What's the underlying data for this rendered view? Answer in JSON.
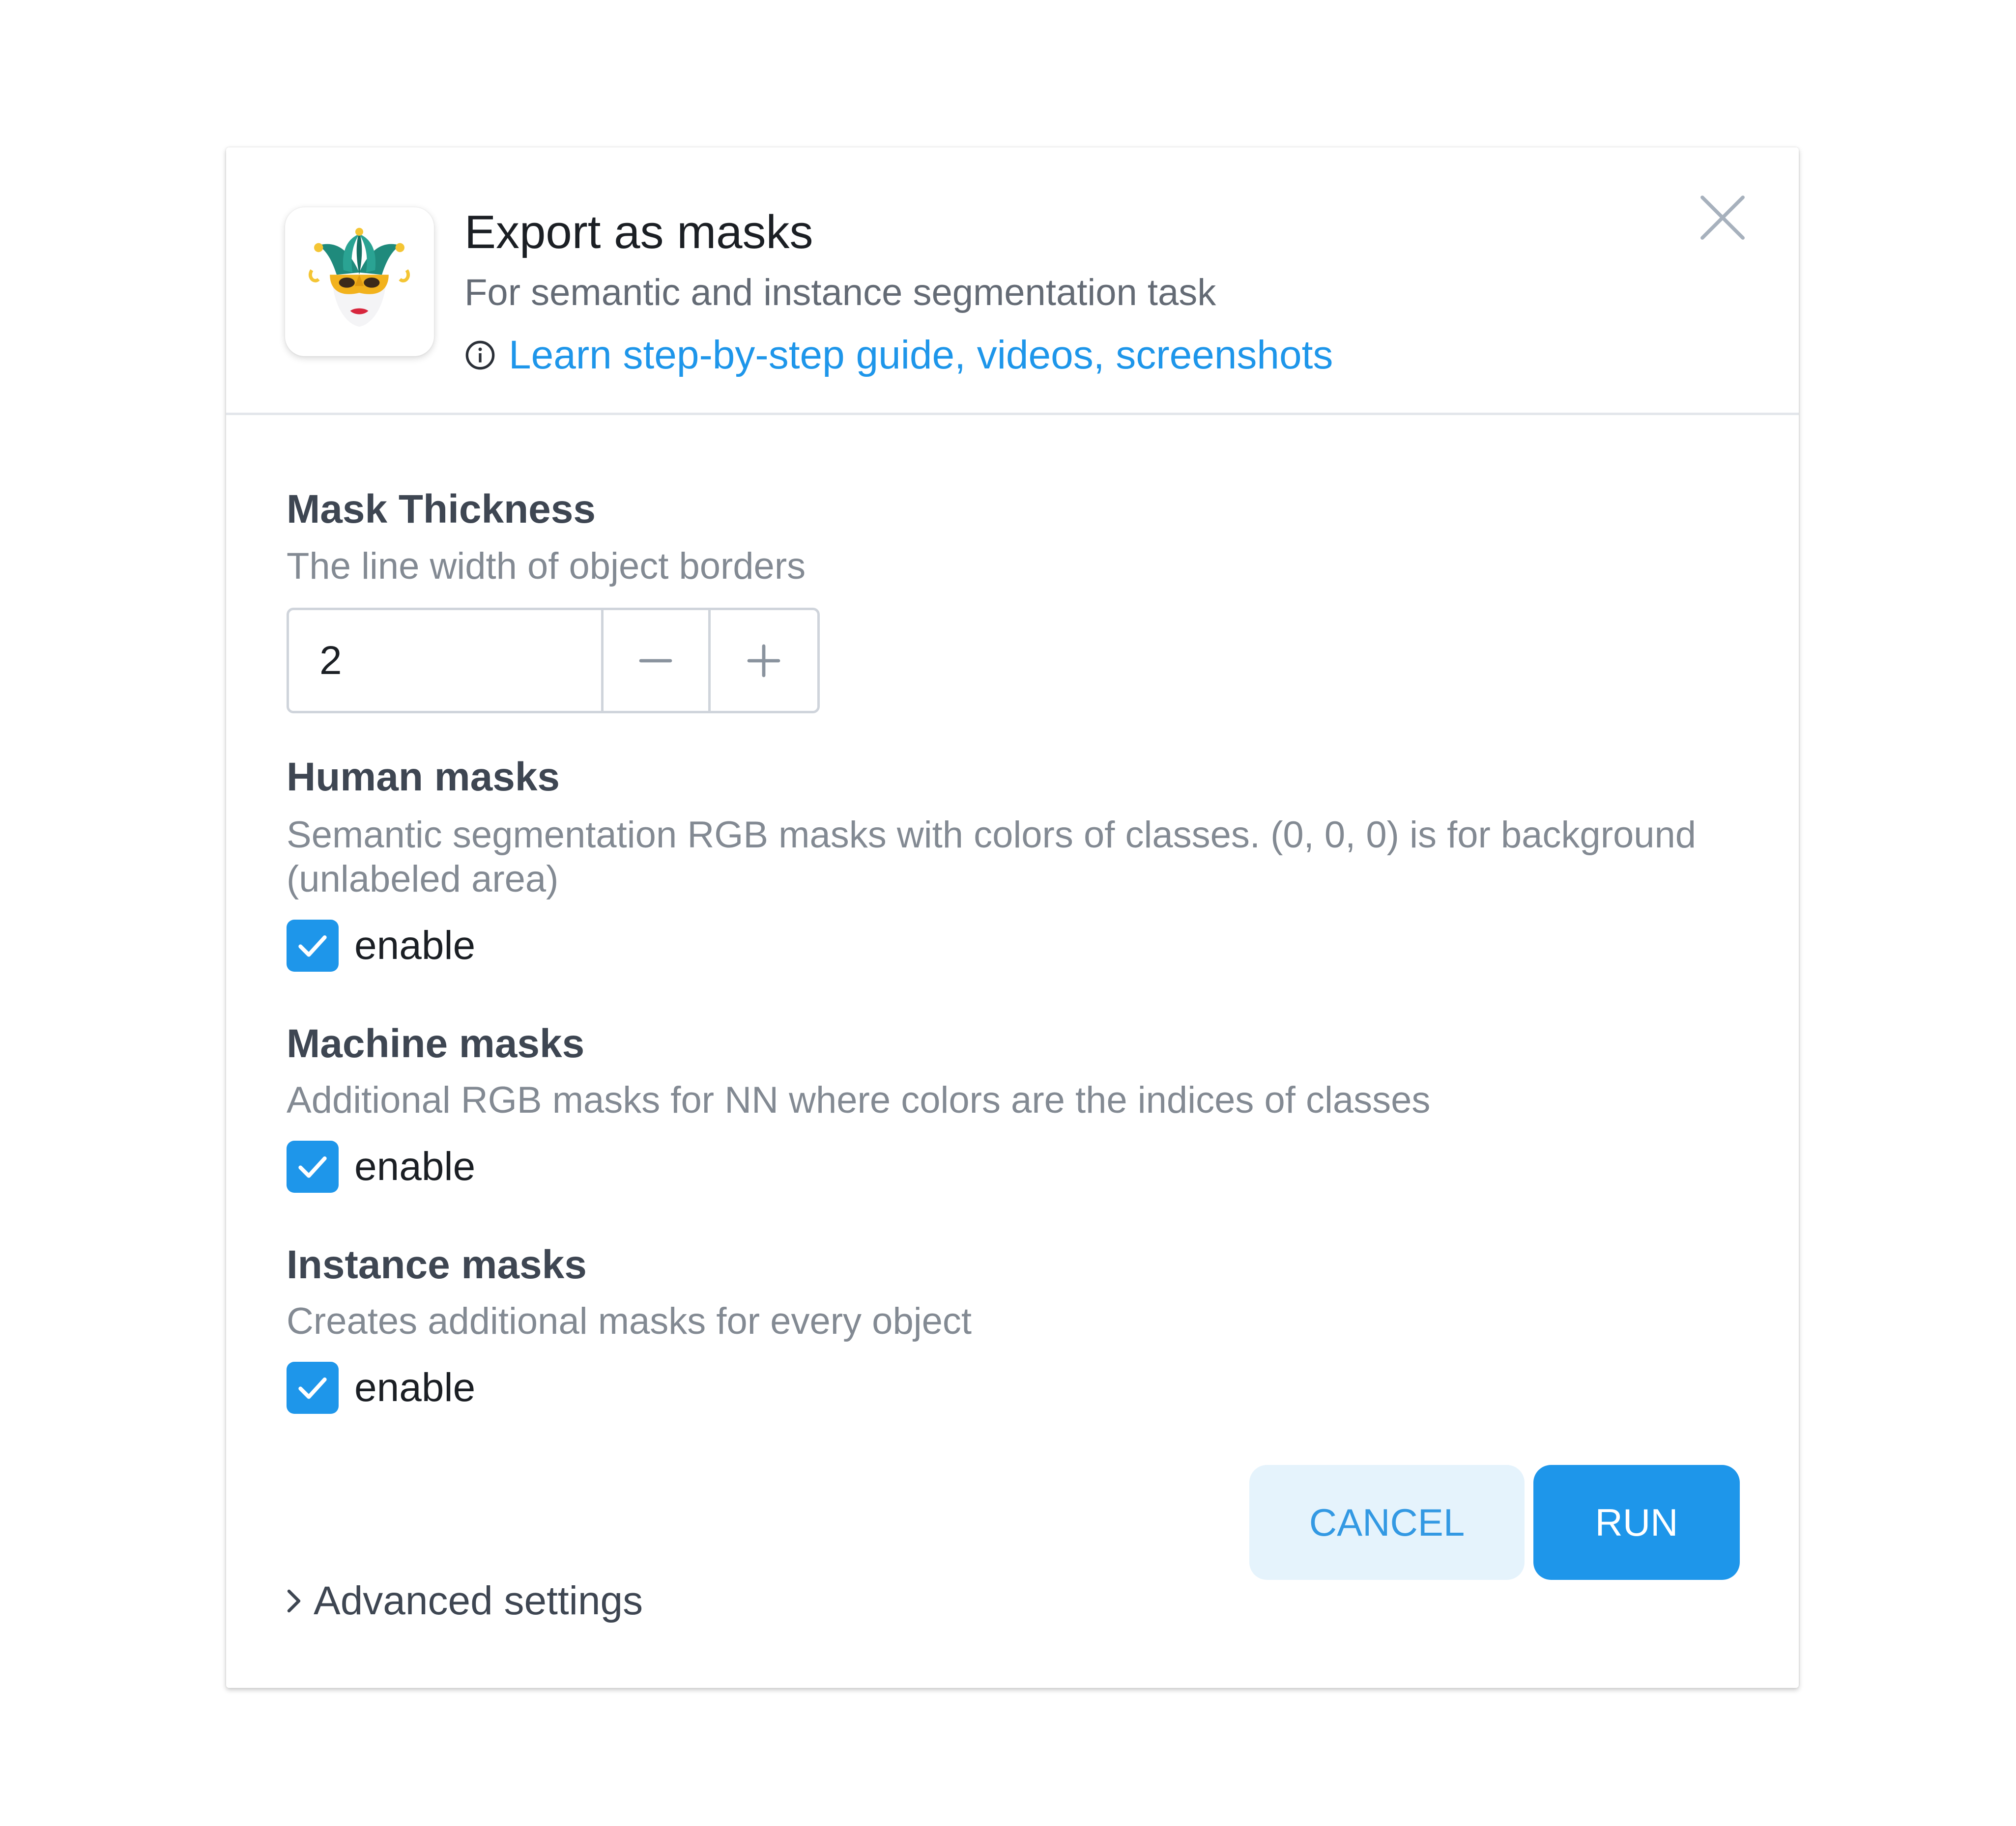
{
  "dialog": {
    "title": "Export as masks",
    "subtitle": "For semantic and instance segmentation task",
    "guide_link": "Learn step-by-step guide, videos, screenshots",
    "app_icon": "jester-mask-icon",
    "close_icon": "close-icon"
  },
  "mask_thickness": {
    "title": "Mask Thickness",
    "description": "The line width of object borders",
    "value": "2"
  },
  "human_masks": {
    "title": "Human masks",
    "description": "Semantic segmentation RGB masks with colors of classes. (0, 0, 0) is for background (unlabeled area)",
    "checkbox_label": "enable",
    "checked": true
  },
  "machine_masks": {
    "title": "Machine masks",
    "description": "Additional RGB masks for NN where colors are the indices of classes",
    "checkbox_label": "enable",
    "checked": true
  },
  "instance_masks": {
    "title": "Instance masks",
    "description": "Creates additional masks for every object",
    "checkbox_label": "enable",
    "checked": true
  },
  "actions": {
    "cancel_label": "CANCEL",
    "run_label": "RUN",
    "advanced_label": "Advanced settings"
  },
  "colors": {
    "accent": "#1e96ea",
    "cancel_bg": "#e5f3fc",
    "title_text": "#3e4652",
    "muted_text": "#838a93"
  }
}
